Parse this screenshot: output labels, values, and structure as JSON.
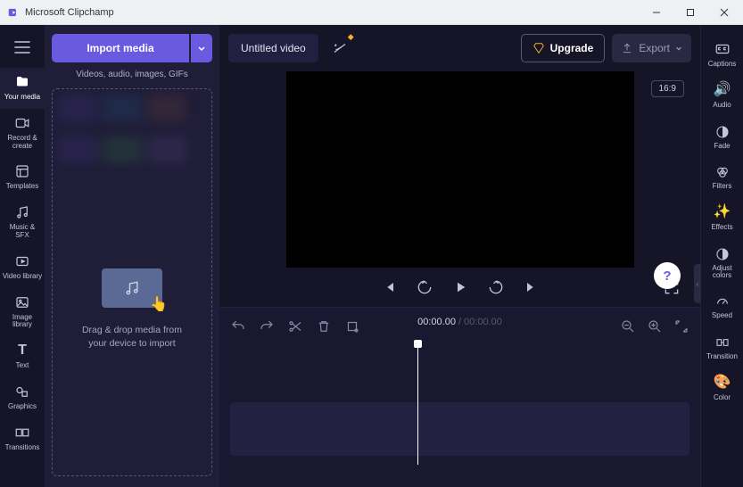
{
  "window": {
    "title": "Microsoft Clipchamp"
  },
  "leftnav": {
    "items": [
      {
        "label": "Your media"
      },
      {
        "label": "Record & create"
      },
      {
        "label": "Templates"
      },
      {
        "label": "Music & SFX"
      },
      {
        "label": "Video library"
      },
      {
        "label": "Image library"
      },
      {
        "label": "Text"
      },
      {
        "label": "Graphics"
      },
      {
        "label": "Transitions"
      }
    ]
  },
  "media": {
    "import_label": "Import media",
    "hint": "Videos, audio, images, GIFs",
    "dropzone_line1": "Drag & drop media from",
    "dropzone_line2": "your device to import"
  },
  "project": {
    "title": "Untitled video",
    "aspect": "16:9"
  },
  "topbar": {
    "upgrade_label": "Upgrade",
    "export_label": "Export"
  },
  "rightnav": {
    "items": [
      {
        "label": "Captions"
      },
      {
        "label": "Audio"
      },
      {
        "label": "Fade"
      },
      {
        "label": "Filters"
      },
      {
        "label": "Effects"
      },
      {
        "label": "Adjust colors"
      },
      {
        "label": "Speed"
      },
      {
        "label": "Transition"
      },
      {
        "label": "Color"
      }
    ]
  },
  "timeline": {
    "current": "00:00.00",
    "total": "00:00.00"
  },
  "help": {
    "glyph": "?"
  }
}
